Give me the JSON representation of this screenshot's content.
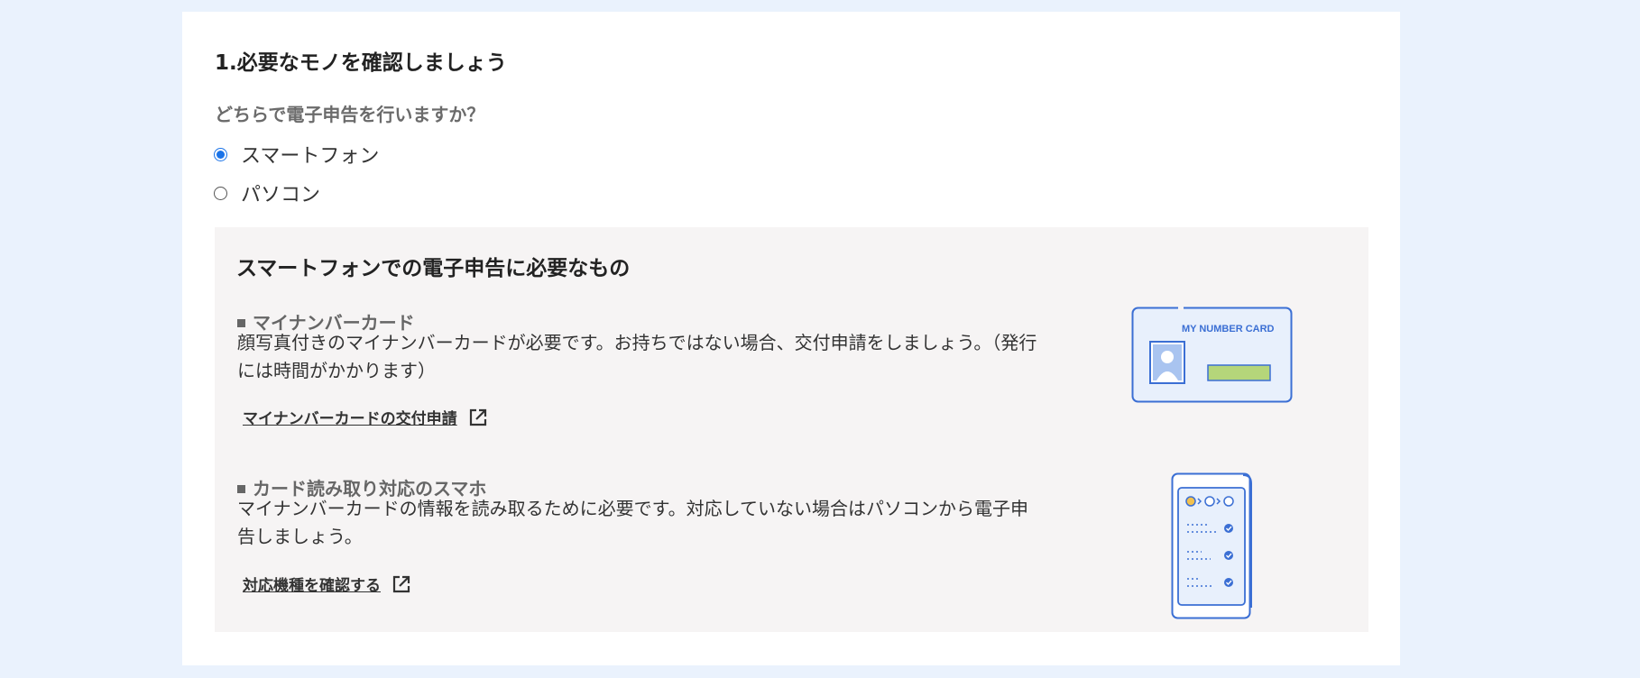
{
  "section": {
    "title": "1.必要なモノを確認しましょう",
    "question": "どちらで電子申告を行いますか？"
  },
  "options": [
    {
      "label": "スマートフォン",
      "selected": true
    },
    {
      "label": "パソコン",
      "selected": false
    }
  ],
  "panel": {
    "title": "スマートフォンでの電子申告に必要なもの",
    "items": [
      {
        "heading": "マイナンバーカード",
        "description": "顔写真付きのマイナンバーカードが必要です。お持ちではない場合、交付申請をしましょう。（発行には時間がかかります）",
        "link": "マイナンバーカードの交付申請",
        "link_icon": "external-link-icon",
        "illustration_text": "MY NUMBER  CARD"
      },
      {
        "heading": "カード読み取り対応のスマホ",
        "description": "マイナンバーカードの情報を読み取るために必要です。対応していない場合はパソコンから電子申告しましょう。",
        "link": "対応機種を確認する",
        "link_icon": "external-link-icon"
      }
    ]
  },
  "colors": {
    "page_background": "#eaf2fd",
    "panel_background": "#f6f4f4",
    "radio_accent": "#1a73e8",
    "illustration_blue": "#3b6fd4",
    "card_green": "#b5d67a"
  }
}
